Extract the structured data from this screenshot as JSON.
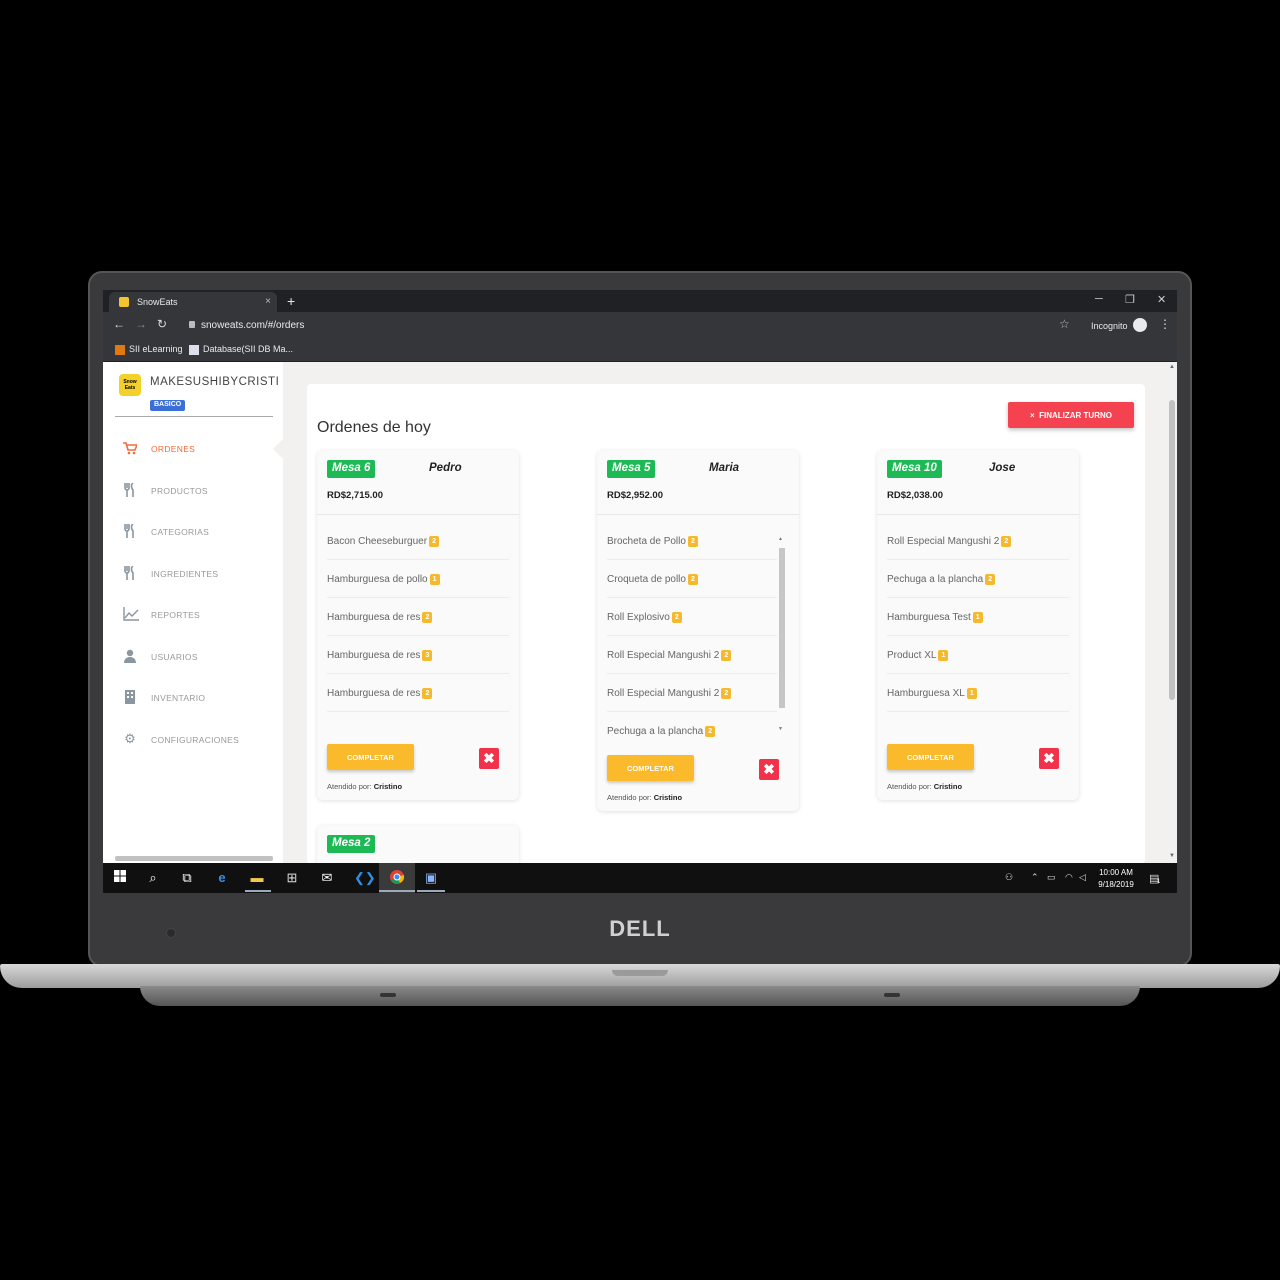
{
  "browser": {
    "tab_title": "SnowEats",
    "tab_close": "×",
    "new_tab": "+",
    "url": "snoweats.com/#/orders",
    "incognito_label": "Incognito",
    "bookmarks": [
      "SII eLearning",
      "Database(SII DB Ma..."
    ],
    "window_controls": [
      "─",
      "❐",
      "✕"
    ],
    "nav": {
      "back": "←",
      "forward": "→",
      "reload": "↻"
    }
  },
  "sidebar": {
    "logo_text": "Snow Eats",
    "shop_name": "MAKESUSHIBYCRISTINA",
    "plan_badge": "BASICO",
    "items": [
      {
        "label": "ORDENES",
        "icon": "cart-icon",
        "active": true
      },
      {
        "label": "PRODUCTOS",
        "icon": "utensils-icon",
        "active": false
      },
      {
        "label": "CATEGORIAS",
        "icon": "utensils-icon",
        "active": false
      },
      {
        "label": "INGREDIENTES",
        "icon": "utensils-icon",
        "active": false
      },
      {
        "label": "REPORTES",
        "icon": "chart-line-icon",
        "active": false
      },
      {
        "label": "USUARIOS",
        "icon": "user-icon",
        "active": false
      },
      {
        "label": "INVENTARIO",
        "icon": "building-icon",
        "active": false
      },
      {
        "label": "CONFIGURACIONES",
        "icon": "gear-icon",
        "active": false
      }
    ]
  },
  "main": {
    "title": "Ordenes de hoy",
    "finalizar_label": "FINALIZAR TURNO",
    "finalizar_icon": "×",
    "orders": [
      {
        "mesa": "Mesa 6",
        "waiter": "Pedro",
        "total": "RD$2,715.00",
        "items": [
          {
            "name": "Bacon Cheeseburguer",
            "qty": "2"
          },
          {
            "name": "Hamburguesa de pollo",
            "qty": "1"
          },
          {
            "name": "Hamburguesa de res",
            "qty": "2"
          },
          {
            "name": "Hamburguesa de res",
            "qty": "3"
          },
          {
            "name": "Hamburguesa de res",
            "qty": "2"
          }
        ],
        "complete_label": "COMPLETAR",
        "cancel_label": "✖",
        "attended_prefix": "Atendido por:",
        "attended_by": "Cristino"
      },
      {
        "mesa": "Mesa 5",
        "waiter": "Maria",
        "total": "RD$2,952.00",
        "items": [
          {
            "name": "Brocheta de Pollo",
            "qty": "2"
          },
          {
            "name": "Croqueta de pollo",
            "qty": "2"
          },
          {
            "name": "Roll Explosivo",
            "qty": "2"
          },
          {
            "name": "Roll Especial Mangushi 2",
            "qty": "2"
          },
          {
            "name": "Roll Especial Mangushi 2",
            "qty": "2"
          },
          {
            "name": "Pechuga a la plancha",
            "qty": "2"
          }
        ],
        "complete_label": "COMPLETAR",
        "cancel_label": "✖",
        "attended_prefix": "Atendido por:",
        "attended_by": "Cristino"
      },
      {
        "mesa": "Mesa 10",
        "waiter": "Jose",
        "total": "RD$2,038.00",
        "items": [
          {
            "name": "Roll Especial Mangushi 2",
            "qty": "2"
          },
          {
            "name": "Pechuga a la plancha",
            "qty": "2"
          },
          {
            "name": "Hamburguesa Test",
            "qty": "1"
          },
          {
            "name": "Product XL",
            "qty": "1"
          },
          {
            "name": "Hamburguesa XL",
            "qty": "1"
          }
        ],
        "complete_label": "COMPLETAR",
        "cancel_label": "✖",
        "attended_prefix": "Atendido por:",
        "attended_by": "Cristino"
      },
      {
        "mesa": "Mesa 2"
      }
    ]
  },
  "taskbar": {
    "time": "10:00 AM",
    "date": "9/18/2019",
    "notification_count": "1"
  },
  "laptop": {
    "brand": "DELL"
  },
  "colors": {
    "accent_orange": "#f26b3a",
    "mesa_green": "#1db954",
    "complete_yellow": "#fbb92c",
    "cancel_red": "#f2314b",
    "finalizar_red": "#f44250",
    "plan_blue": "#3b6fd8"
  }
}
